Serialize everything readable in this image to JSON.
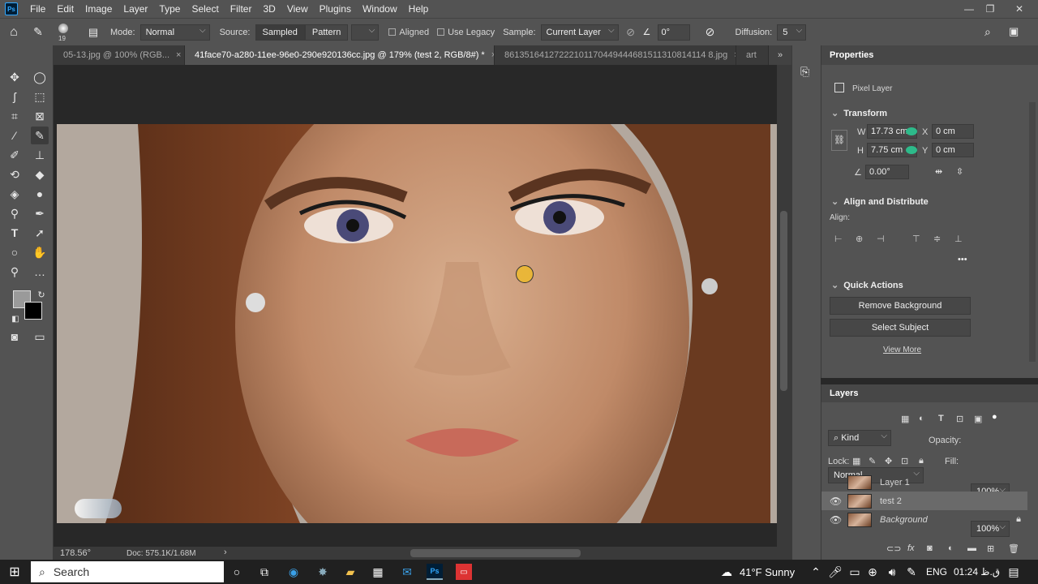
{
  "menu": {
    "app_logo": "Ps",
    "items": [
      "File",
      "Edit",
      "Image",
      "Layer",
      "Type",
      "Select",
      "Filter",
      "3D",
      "View",
      "Plugins",
      "Window",
      "Help"
    ]
  },
  "options": {
    "brush_size": "19",
    "mode_label": "Mode:",
    "mode_value": "Normal",
    "source_label": "Source:",
    "sampled": "Sampled",
    "pattern": "Pattern",
    "aligned": "Aligned",
    "use_legacy": "Use Legacy",
    "sample_label": "Sample:",
    "sample_value": "Current Layer",
    "angle_value": "0°",
    "diffusion_label": "Diffusion:",
    "diffusion_value": "5"
  },
  "tabs": [
    {
      "label": "05-13.jpg @ 100% (RGB..."
    },
    {
      "label": "41face70-a280-11ee-96e0-290e920136cc.jpg @ 179% (test 2, RGB/8#) *"
    },
    {
      "label": "86135164127222101170449444681511310814114 8.jpg"
    },
    {
      "label": "art"
    }
  ],
  "status": {
    "zoom": "178.56°",
    "doc": "Doc: 575.1K/1.68M"
  },
  "properties": {
    "title": "Properties",
    "layer_type": "Pixel Layer",
    "transform_title": "Transform",
    "w_label": "W",
    "w_value": "17.73 cm",
    "h_label": "H",
    "h_value": "7.75 cm",
    "x_label": "X",
    "x_value": "0 cm",
    "y_label": "Y",
    "y_value": "0 cm",
    "angle_value": "0.00°",
    "align_title": "Align and Distribute",
    "align_label": "Align:",
    "quick_title": "Quick Actions",
    "remove_bg": "Remove Background",
    "select_subject": "Select Subject",
    "view_more": "View More"
  },
  "layers": {
    "title": "Layers",
    "kind": "Kind",
    "blend": "Normal",
    "opacity_label": "Opacity:",
    "opacity_value": "100%",
    "lock_label": "Lock:",
    "fill_label": "Fill:",
    "fill_value": "100%",
    "items": [
      {
        "name": "Layer 1",
        "visible": false
      },
      {
        "name": "test 2",
        "visible": true
      },
      {
        "name": "Background",
        "visible": true
      }
    ]
  },
  "taskbar": {
    "search": "Search",
    "weather": "41°F  Sunny",
    "lang": "ENG",
    "time": "01:24 ق.ظ"
  },
  "colors": {
    "ps_blue": "#31a8ff",
    "panel": "#535353",
    "canvas_bg": "#282828"
  }
}
